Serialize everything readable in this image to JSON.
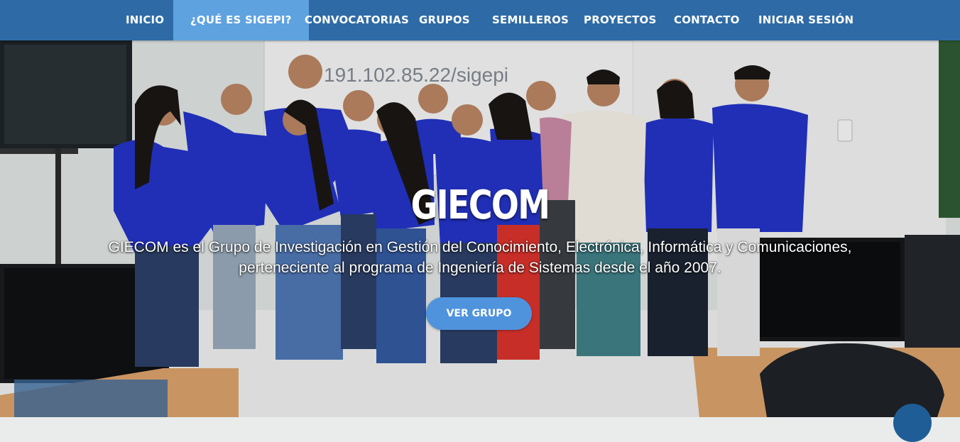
{
  "nav": {
    "items": [
      {
        "label": "INICIO"
      },
      {
        "label": "¿QUÉ ES SIGEPI?"
      },
      {
        "label": "CONVOCATORIAS"
      },
      {
        "label": "GRUPOS"
      },
      {
        "label": "SEMILLEROS"
      },
      {
        "label": "PROYECTOS"
      },
      {
        "label": "CONTACTO"
      },
      {
        "label": "INICIAR SESIÓN"
      }
    ],
    "active_index": 1
  },
  "hero": {
    "title": "GIECOM",
    "description_line1": "GIECOM es el Grupo de Investigación en Gestión del Conocimiento, Electrónica, Informática y Comunicaciones,",
    "description_line2": "perteneciente al programa de Ingeniería de Sistemas desde el año 2007.",
    "button_label": "VER GRUPO",
    "whiteboard_text": "191.102.85.22/sigepi"
  },
  "colors": {
    "navbar": "#2e6ba6",
    "nav_active": "#5ea2e0",
    "button": "#4f93dd",
    "shirt_blue": "#2333c6"
  }
}
